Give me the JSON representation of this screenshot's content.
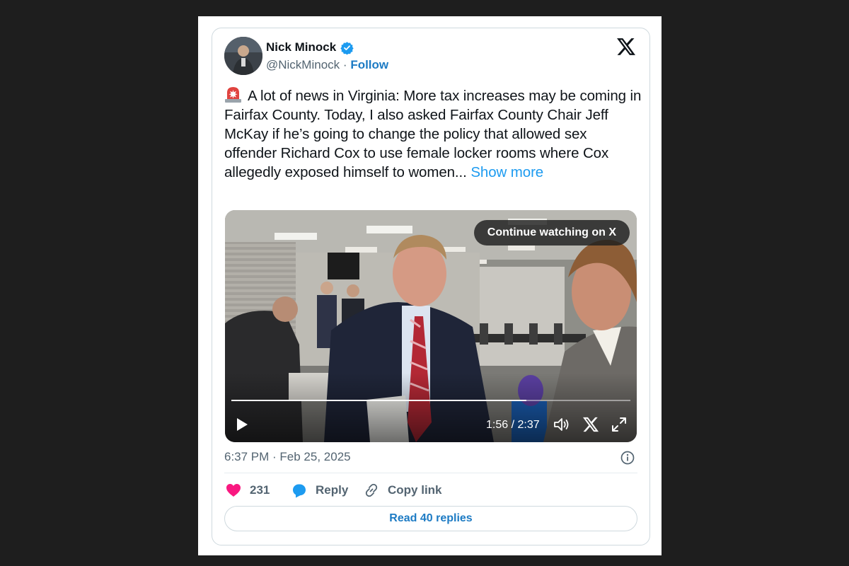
{
  "author": {
    "name": "Nick Minock",
    "handle": "@NickMinock",
    "separator": "·",
    "follow_label": "Follow",
    "avatar_icon": "profile-photo"
  },
  "brand": {
    "logo_icon": "x-logo-icon",
    "color": "#0f1419"
  },
  "tweet": {
    "emoji_icon": "police-siren-emoji",
    "text": "A lot of news in Virginia: More tax increases may be coming in Fairfax County.  Today, I also asked Fairfax County Chair Jeff McKay if he’s going to change the policy that allowed sex offender Richard Cox to use female locker rooms where Cox allegedly exposed himself to women...",
    "show_more_label": "Show more"
  },
  "video": {
    "continue_label": "Continue watching on X",
    "current_time": "1:56",
    "duration": "2:37",
    "time_display": "1:56 / 2:37",
    "progress": 0.739,
    "icons": [
      "play-icon",
      "volume-icon",
      "x-icon",
      "fullscreen-icon"
    ]
  },
  "meta": {
    "timestamp": "6:37 PM · Feb 25, 2025",
    "info_icon": "info-icon"
  },
  "actions": {
    "likes_count": "231",
    "reply_label": "Reply",
    "copy_link_label": "Copy link",
    "read_replies_label": "Read 40 replies"
  },
  "colors": {
    "accent": "#1d9bf0",
    "link": "#1d7bc4",
    "like": "#f91880",
    "reply": "#1d9bf0",
    "muted": "#536471",
    "background": "#1e1e1e"
  }
}
